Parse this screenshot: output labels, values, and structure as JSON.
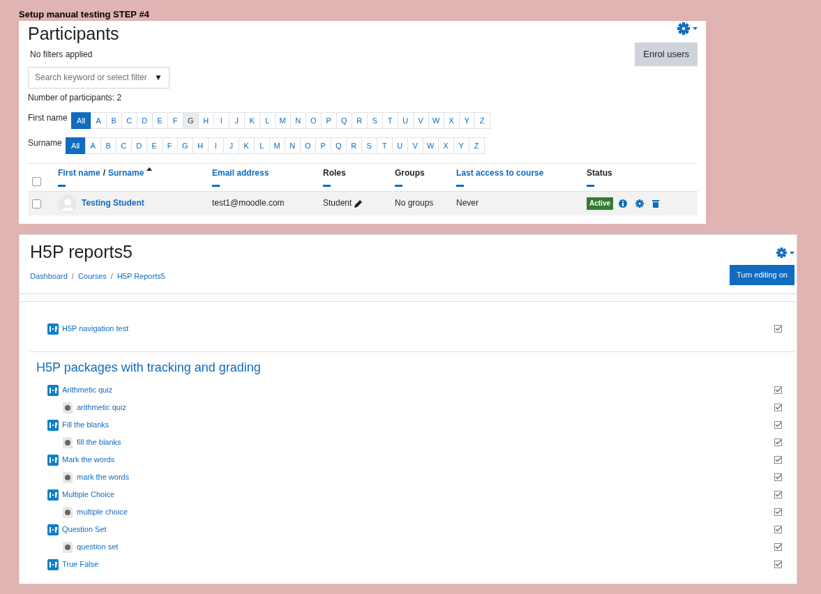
{
  "caption": "Setup manual testing STEP #4",
  "participants": {
    "title": "Participants",
    "filter_status": "No filters applied",
    "enrol_button": "Enrol users",
    "search": {
      "placeholder": "Search keyword or select filter",
      "caret": "▼"
    },
    "count": "Number of participants: 2",
    "initials_bars": [
      {
        "label": "First name",
        "letters": [
          {
            "label": "All",
            "selected": true,
            "hover": false
          },
          {
            "label": "A",
            "selected": false,
            "hover": false
          },
          {
            "label": "B",
            "selected": false,
            "hover": false
          },
          {
            "label": "C",
            "selected": false,
            "hover": false
          },
          {
            "label": "D",
            "selected": false,
            "hover": false
          },
          {
            "label": "E",
            "selected": false,
            "hover": false
          },
          {
            "label": "F",
            "selected": false,
            "hover": false
          },
          {
            "label": "G",
            "selected": false,
            "hover": true
          },
          {
            "label": "H",
            "selected": false,
            "hover": false
          },
          {
            "label": "I",
            "selected": false,
            "hover": false
          },
          {
            "label": "J",
            "selected": false,
            "hover": false
          },
          {
            "label": "K",
            "selected": false,
            "hover": false
          },
          {
            "label": "L",
            "selected": false,
            "hover": false
          },
          {
            "label": "M",
            "selected": false,
            "hover": false
          },
          {
            "label": "N",
            "selected": false,
            "hover": false
          },
          {
            "label": "O",
            "selected": false,
            "hover": false
          },
          {
            "label": "P",
            "selected": false,
            "hover": false
          },
          {
            "label": "Q",
            "selected": false,
            "hover": false
          },
          {
            "label": "R",
            "selected": false,
            "hover": false
          },
          {
            "label": "S",
            "selected": false,
            "hover": false
          },
          {
            "label": "T",
            "selected": false,
            "hover": false
          },
          {
            "label": "U",
            "selected": false,
            "hover": false
          },
          {
            "label": "V",
            "selected": false,
            "hover": false
          },
          {
            "label": "W",
            "selected": false,
            "hover": false
          },
          {
            "label": "X",
            "selected": false,
            "hover": false
          },
          {
            "label": "Y",
            "selected": false,
            "hover": false
          },
          {
            "label": "Z",
            "selected": false,
            "hover": false
          }
        ]
      },
      {
        "label": "Surname",
        "letters": [
          {
            "label": "All",
            "selected": true,
            "hover": false
          },
          {
            "label": "A",
            "selected": false,
            "hover": false
          },
          {
            "label": "B",
            "selected": false,
            "hover": false
          },
          {
            "label": "C",
            "selected": false,
            "hover": false
          },
          {
            "label": "D",
            "selected": false,
            "hover": false
          },
          {
            "label": "E",
            "selected": false,
            "hover": false
          },
          {
            "label": "F",
            "selected": false,
            "hover": false
          },
          {
            "label": "G",
            "selected": false,
            "hover": false
          },
          {
            "label": "H",
            "selected": false,
            "hover": false
          },
          {
            "label": "I",
            "selected": false,
            "hover": false
          },
          {
            "label": "J",
            "selected": false,
            "hover": false
          },
          {
            "label": "K",
            "selected": false,
            "hover": false
          },
          {
            "label": "L",
            "selected": false,
            "hover": false
          },
          {
            "label": "M",
            "selected": false,
            "hover": false
          },
          {
            "label": "N",
            "selected": false,
            "hover": false
          },
          {
            "label": "O",
            "selected": false,
            "hover": false
          },
          {
            "label": "P",
            "selected": false,
            "hover": false
          },
          {
            "label": "Q",
            "selected": false,
            "hover": false
          },
          {
            "label": "R",
            "selected": false,
            "hover": false
          },
          {
            "label": "S",
            "selected": false,
            "hover": false
          },
          {
            "label": "T",
            "selected": false,
            "hover": false
          },
          {
            "label": "U",
            "selected": false,
            "hover": false
          },
          {
            "label": "V",
            "selected": false,
            "hover": false
          },
          {
            "label": "W",
            "selected": false,
            "hover": false
          },
          {
            "label": "X",
            "selected": false,
            "hover": false
          },
          {
            "label": "Y",
            "selected": false,
            "hover": false
          },
          {
            "label": "Z",
            "selected": false,
            "hover": false
          }
        ]
      }
    ],
    "table": {
      "select_all": {
        "checked": false
      },
      "columns": [
        {
          "labels": [
            "First name",
            "Surname"
          ],
          "separator": "/",
          "link": true,
          "sorted_ascending": true
        },
        {
          "labels": [
            "Email address"
          ],
          "link": true
        },
        {
          "labels": [
            "Roles"
          ],
          "link": false
        },
        {
          "labels": [
            "Groups"
          ],
          "link": false
        },
        {
          "labels": [
            "Last access to course"
          ],
          "link": true
        },
        {
          "labels": [
            "Status"
          ],
          "link": false
        }
      ],
      "rows": [
        {
          "selected": false,
          "name": "Testing Student",
          "email": "test1@moodle.com",
          "role": "Student",
          "groups": "No groups",
          "last_access": "Never",
          "status": "Active"
        }
      ]
    }
  },
  "course": {
    "title": "H5P reports5",
    "breadcrumb": [
      {
        "label": "Dashboard",
        "separator": "/"
      },
      {
        "label": "Courses",
        "separator": "/"
      },
      {
        "label": "H5P Reports5"
      }
    ],
    "edit_button": "Turn editing on",
    "sections": [
      {
        "activities": [
          {
            "name": "H5P navigation test",
            "kind": "h5p",
            "completed": true
          }
        ]
      },
      {
        "title": "H5P packages with tracking and grading",
        "activities": [
          {
            "name": "Arithmetic quiz",
            "kind": "h5p",
            "completed": true,
            "children": [
              {
                "name": "arithmetic quiz",
                "kind": "file",
                "completed": true
              }
            ]
          },
          {
            "name": "Fill the blanks",
            "kind": "h5p",
            "completed": true,
            "children": [
              {
                "name": "fill the blanks",
                "kind": "file",
                "completed": true
              }
            ]
          },
          {
            "name": "Mark the words",
            "kind": "h5p",
            "completed": true,
            "children": [
              {
                "name": "mark the words",
                "kind": "file",
                "completed": true
              }
            ]
          },
          {
            "name": "Multiple Choice",
            "kind": "h5p",
            "completed": true,
            "children": [
              {
                "name": "multiple choice",
                "kind": "file",
                "completed": true
              }
            ]
          },
          {
            "name": "Question Set",
            "kind": "h5p",
            "completed": true,
            "children": [
              {
                "name": "question set",
                "kind": "file",
                "completed": true
              }
            ]
          },
          {
            "name": "True False",
            "kind": "h5p",
            "completed": true
          }
        ]
      }
    ]
  }
}
